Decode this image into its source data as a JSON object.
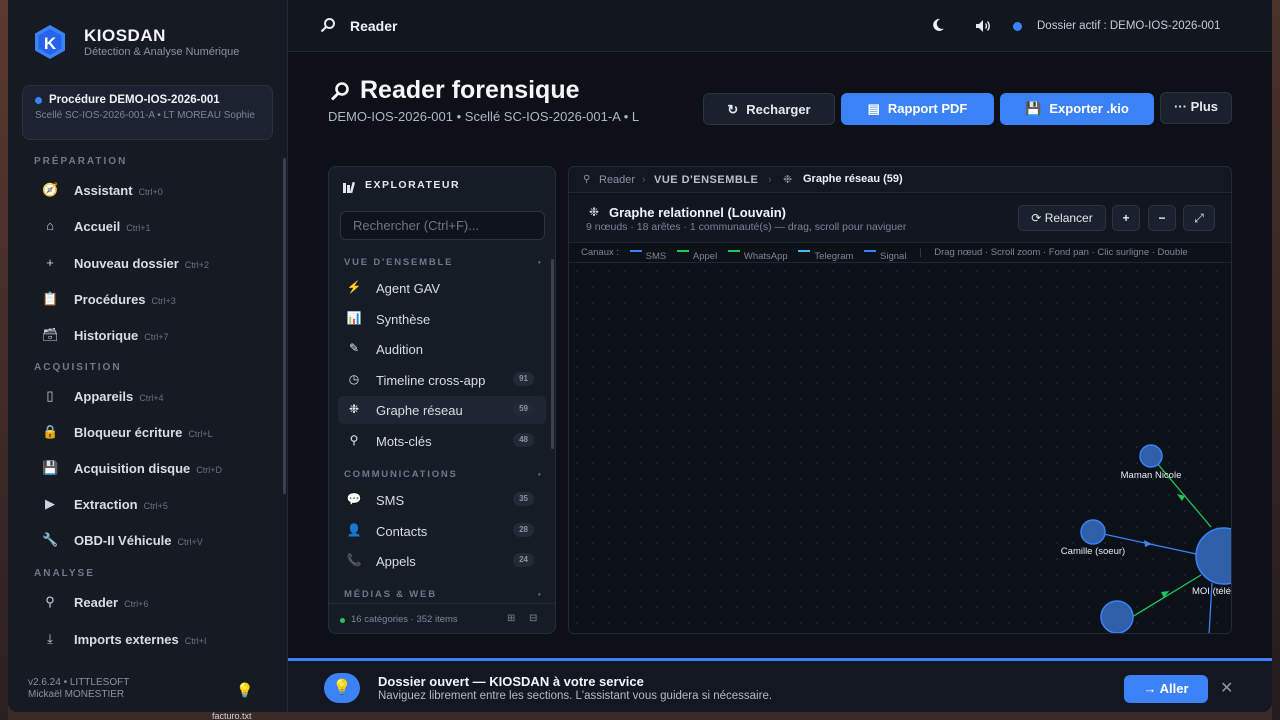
{
  "colors": {
    "accent": "#3b82f6",
    "sms": "#3b82f6",
    "appel": "#22c55e",
    "whatsapp": "#22c55e",
    "telegram": "#38bdf8",
    "signal": "#3b82f6"
  },
  "desktop": {
    "file_label": "facturo.txt"
  },
  "app": {
    "brand": "KIOSDAN",
    "brand_sub": "Détection & Analyse Numérique",
    "logo_letter": "K"
  },
  "procedure": {
    "title": "Procédure DEMO-IOS-2026-001",
    "subtitle": "Scellé SC-IOS-2026-001-A • LT MOREAU Sophie"
  },
  "sidebar": {
    "sections": [
      {
        "label": "PRÉPARATION",
        "items": [
          {
            "icon": "compass-icon",
            "glyph": "🧭",
            "label": "Assistant",
            "shortcut": "Ctrl+0"
          },
          {
            "icon": "home-icon",
            "glyph": "⌂",
            "label": "Accueil",
            "shortcut": "Ctrl+1"
          },
          {
            "icon": "plus-icon",
            "glyph": "+",
            "label": "Nouveau dossier",
            "shortcut": "Ctrl+2"
          },
          {
            "icon": "clipboard-icon",
            "glyph": "📋",
            "label": "Procédures",
            "shortcut": "Ctrl+3"
          },
          {
            "icon": "archive-icon",
            "glyph": "🗃",
            "label": "Historique",
            "shortcut": "Ctrl+7"
          }
        ]
      },
      {
        "label": "ACQUISITION",
        "items": [
          {
            "icon": "phone-icon",
            "glyph": "▯",
            "label": "Appareils",
            "shortcut": "Ctrl+4"
          },
          {
            "icon": "lock-icon",
            "glyph": "🔒",
            "label": "Bloqueur écriture",
            "shortcut": "Ctrl+L"
          },
          {
            "icon": "disk-icon",
            "glyph": "💾",
            "label": "Acquisition disque",
            "shortcut": "Ctrl+D"
          },
          {
            "icon": "play-icon",
            "glyph": "▶",
            "label": "Extraction",
            "shortcut": "Ctrl+5"
          },
          {
            "icon": "wrench-icon",
            "glyph": "🔧",
            "label": "OBD-II Véhicule",
            "shortcut": "Ctrl+V"
          }
        ]
      },
      {
        "label": "ANALYSE",
        "items": [
          {
            "icon": "search-icon",
            "glyph": "⚲",
            "label": "Reader",
            "shortcut": "Ctrl+6"
          },
          {
            "icon": "download-icon",
            "glyph": "⤓",
            "label": "Imports externes",
            "shortcut": "Ctrl+I"
          }
        ]
      }
    ],
    "version": "v2.6.24 • LITTLESOFT",
    "user": "Mickaël MONESTIER"
  },
  "topbar": {
    "title": "Reader",
    "dossier": "Dossier actif : DEMO-IOS-2026-001"
  },
  "page": {
    "title": "Reader forensique",
    "subtitle": "DEMO-IOS-2026-001 • Scellé SC-IOS-2026-001-A • L"
  },
  "actions": {
    "reload": "Recharger",
    "pdf": "Rapport PDF",
    "export": "Exporter .kio",
    "more": "Plus"
  },
  "explorer": {
    "title": "EXPLORATEUR",
    "search_placeholder": "Rechercher (Ctrl+F)...",
    "sections": [
      {
        "label": "VUE D'ENSEMBLE",
        "items": [
          {
            "icon": "bolt-icon",
            "glyph": "⚡",
            "label": "Agent GAV",
            "count": ""
          },
          {
            "icon": "bar-chart-icon",
            "glyph": "📊",
            "label": "Synthèse",
            "count": ""
          },
          {
            "icon": "pencil-icon",
            "glyph": "✎",
            "label": "Audition",
            "count": ""
          },
          {
            "icon": "clock-icon",
            "glyph": "◷",
            "label": "Timeline cross-app",
            "count": "91"
          },
          {
            "icon": "network-icon",
            "glyph": "❉",
            "label": "Graphe réseau",
            "count": "59"
          },
          {
            "icon": "search-icon",
            "glyph": "⚲",
            "label": "Mots-clés",
            "count": "48"
          }
        ]
      },
      {
        "label": "COMMUNICATIONS",
        "items": [
          {
            "icon": "chat-icon",
            "glyph": "💬",
            "label": "SMS",
            "count": "35"
          },
          {
            "icon": "contact-icon",
            "glyph": "👤",
            "label": "Contacts",
            "count": "28"
          },
          {
            "icon": "phone-call-icon",
            "glyph": "📞",
            "label": "Appels",
            "count": "24"
          }
        ]
      },
      {
        "label": "MÉDIAS & WEB",
        "items": []
      }
    ],
    "footer": "16 catégories · 352 items"
  },
  "panel": {
    "crumbs": [
      "Reader",
      "VUE D'ENSEMBLE",
      "Graphe réseau (59)"
    ],
    "graph_title": "Graphe relationnel (Louvain)",
    "graph_sub": "9 nœuds · 18 arêtes · 1 communauté(s) — drag, scroll pour naviguer",
    "relaunch": "Relancer",
    "legend_prefix": "Canaux :",
    "channels": [
      "SMS",
      "Appel",
      "WhatsApp",
      "Telegram",
      "Signal"
    ],
    "hint": "Drag nœud · Scroll zoom · Fond pan · Clic surligne · Double",
    "nodes": [
      "Maman Nicole",
      "Camille (soeur)",
      "MOI (télé"
    ]
  },
  "banner": {
    "title": "Dossier ouvert — KIOSDAN à votre service",
    "subtitle": "Naviguez librement entre les sections. L'assistant vous guidera si nécessaire.",
    "go": "Aller"
  }
}
